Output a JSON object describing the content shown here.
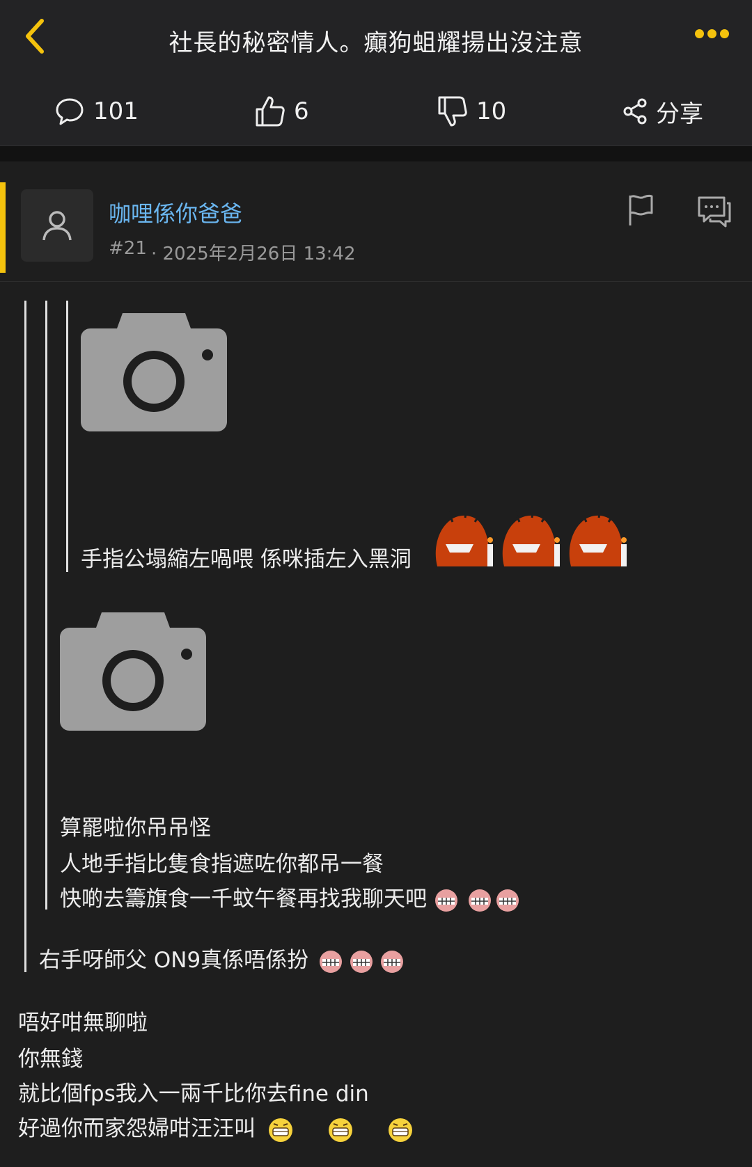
{
  "header": {
    "title": "社長的秘密情人。癲狗蛆耀揚出沒注意"
  },
  "stats": {
    "comments": "101",
    "likes": "6",
    "dislikes": "10",
    "share_label": "分享"
  },
  "post": {
    "username": "咖哩係你爸爸",
    "number": "#21",
    "date": "· 2025年2月26日 13:42"
  },
  "quote3": {
    "line1": "手指公塌縮左喎喂 係咪插左入黑洞"
  },
  "quote2": {
    "line1": "算罷啦你吊吊怪",
    "line2": "人地手指比隻食指遮咗你都吊一餐",
    "line3": "快啲去籌旗食一千蚊午餐再找我聊天吧"
  },
  "quote1": {
    "line1": "右手呀師父 ON9真係唔係扮"
  },
  "reply": {
    "line1": "唔好咁無聊啦",
    "line2": "你無錢",
    "line3": "就比個fps我入一兩千比你去fine din",
    "line4": "好過你而家怨婦咁汪汪叫"
  },
  "colors": {
    "accent": "#f4c20d",
    "username": "#6ab6f0",
    "background": "#1e1e1e"
  },
  "icons": {
    "back": "chevron-left-icon",
    "more": "more-dots-icon",
    "comment": "comment-bubble-icon",
    "like": "thumbs-up-icon",
    "dislike": "thumbs-down-icon",
    "share": "share-icon",
    "flag": "flag-icon",
    "reply": "reply-bubble-icon",
    "avatar": "user-icon",
    "image_placeholder": "camera-icon"
  }
}
